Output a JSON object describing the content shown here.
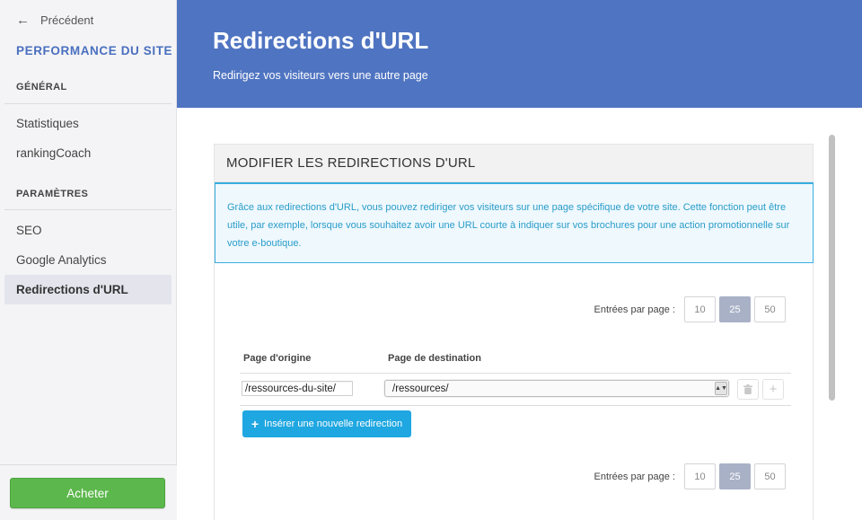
{
  "sidebar": {
    "back_label": "Précédent",
    "site_title": "PERFORMANCE DU SITE",
    "sections": [
      {
        "title": "GÉNÉRAL",
        "items": [
          "Statistiques",
          "rankingCoach"
        ]
      },
      {
        "title": "PARAMÈTRES",
        "items": [
          "SEO",
          "Google Analytics",
          "Redirections d'URL"
        ]
      }
    ],
    "active_item": "Redirections d'URL",
    "buy_label": "Acheter"
  },
  "header": {
    "title": "Redirections d'URL",
    "subtitle": "Redirigez vos visiteurs vers une autre page"
  },
  "panel": {
    "title": "MODIFIER LES REDIRECTIONS D'URL",
    "info_text": "Grâce aux redirections d'URL, vous pouvez rediriger vos visiteurs sur une page spécifique de votre site. Cette fonction peut être utile, par exemple, lorsque vous souhaitez avoir une URL courte à indiquer sur vos brochures pour une action promotionnelle sur votre e-boutique.",
    "pager": {
      "label": "Entrées par page :",
      "options": [
        "10",
        "25",
        "50"
      ],
      "selected": "25"
    },
    "columns": {
      "origin": "Page d'origine",
      "destination": "Page de destination"
    },
    "rows": [
      {
        "origin": "/ressources-du-site/",
        "destination": "/ressources/"
      }
    ],
    "insert_label": "Insérer une nouvelle redirection"
  },
  "colors": {
    "header_bg": "#4f74c1",
    "accent_blue": "#1fa7e1",
    "buy_green": "#5cb74c",
    "site_title": "#4a6fbf"
  }
}
